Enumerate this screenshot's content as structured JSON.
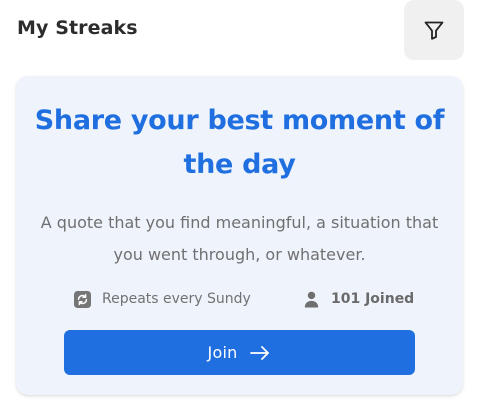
{
  "header": {
    "title": "My Streaks",
    "filter_icon": "filter-funnel-icon"
  },
  "card": {
    "title": "Share your best moment of the day",
    "description": "A quote that you find meaningful, a situation that you went through, or whatever.",
    "repeat": {
      "icon": "repeat-icon",
      "text": "Repeats every Sundy"
    },
    "joined": {
      "icon": "person-icon",
      "text": "101 Joined"
    },
    "join_button": {
      "label": "Join",
      "icon": "arrow-right-icon"
    }
  },
  "colors": {
    "accent": "#1f6fe0",
    "card_background": "#eef3fc",
    "filter_button_background": "#f0f0f0",
    "muted_text": "#707070"
  }
}
